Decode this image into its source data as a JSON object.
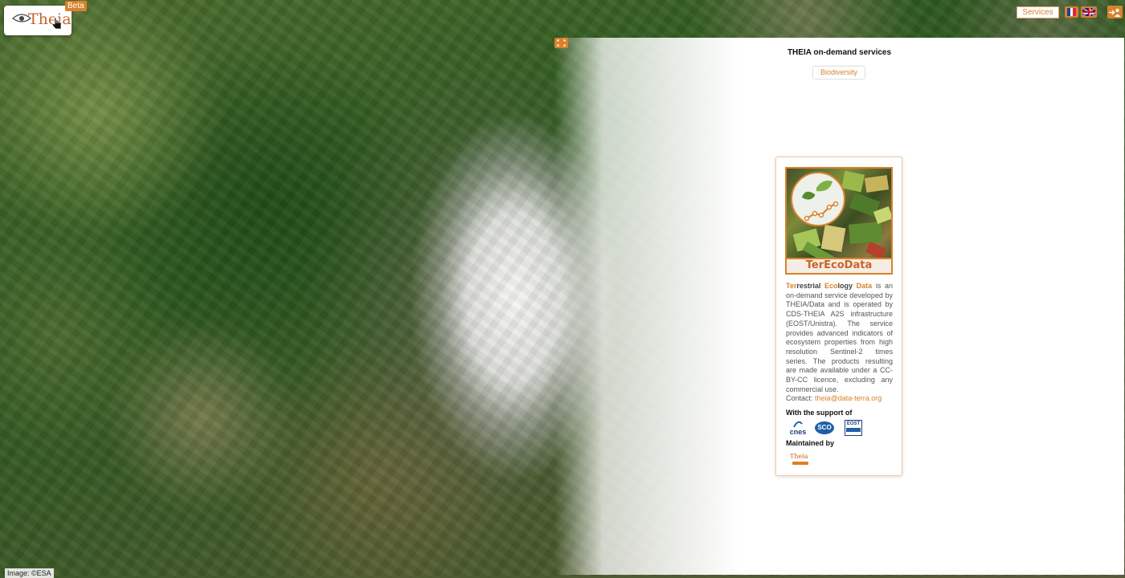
{
  "header": {
    "logo_text": "Theia",
    "beta_label": "Beta",
    "services_label": "Services",
    "languages": [
      "fr",
      "en"
    ]
  },
  "panel": {
    "title": "THEIA on-demand services",
    "tabs": [
      {
        "label": "Biodiversity"
      }
    ],
    "card": {
      "image_title": "TerEcoData",
      "name_parts": [
        "Ter",
        "restrial ",
        "Eco",
        "logy ",
        "Data"
      ],
      "description": "is an on-demand service developed by THEIA/Data and is operated by CDS-THEIA A2S infrastructure (EOST/Unistra). The service provides advanced indicators of ecosystem properties from high resolution Sentinel-2 times series. The products resulting are made available under a CC-BY-CC licence, excluding any commercial use.",
      "contact_label": "Contact:",
      "contact_email": "theia@data-terra.org",
      "support_heading": "With the support of",
      "supporters": [
        {
          "name": "cnes",
          "logo_text": "cnes"
        },
        {
          "name": "sco",
          "logo_text": "SCO"
        },
        {
          "name": "eost",
          "logo_text": "EOST"
        }
      ],
      "maintained_heading": "Maintained by",
      "maintainer_logo_text": "Theia"
    }
  },
  "map": {
    "attribution": "Image: ©ESA"
  },
  "icons": {
    "expand": "expand-icon",
    "login": "login-icon",
    "pointer": "hand-pointer-icon"
  },
  "colors": {
    "accent": "#d9822b",
    "brand_text": "#c9642a"
  }
}
